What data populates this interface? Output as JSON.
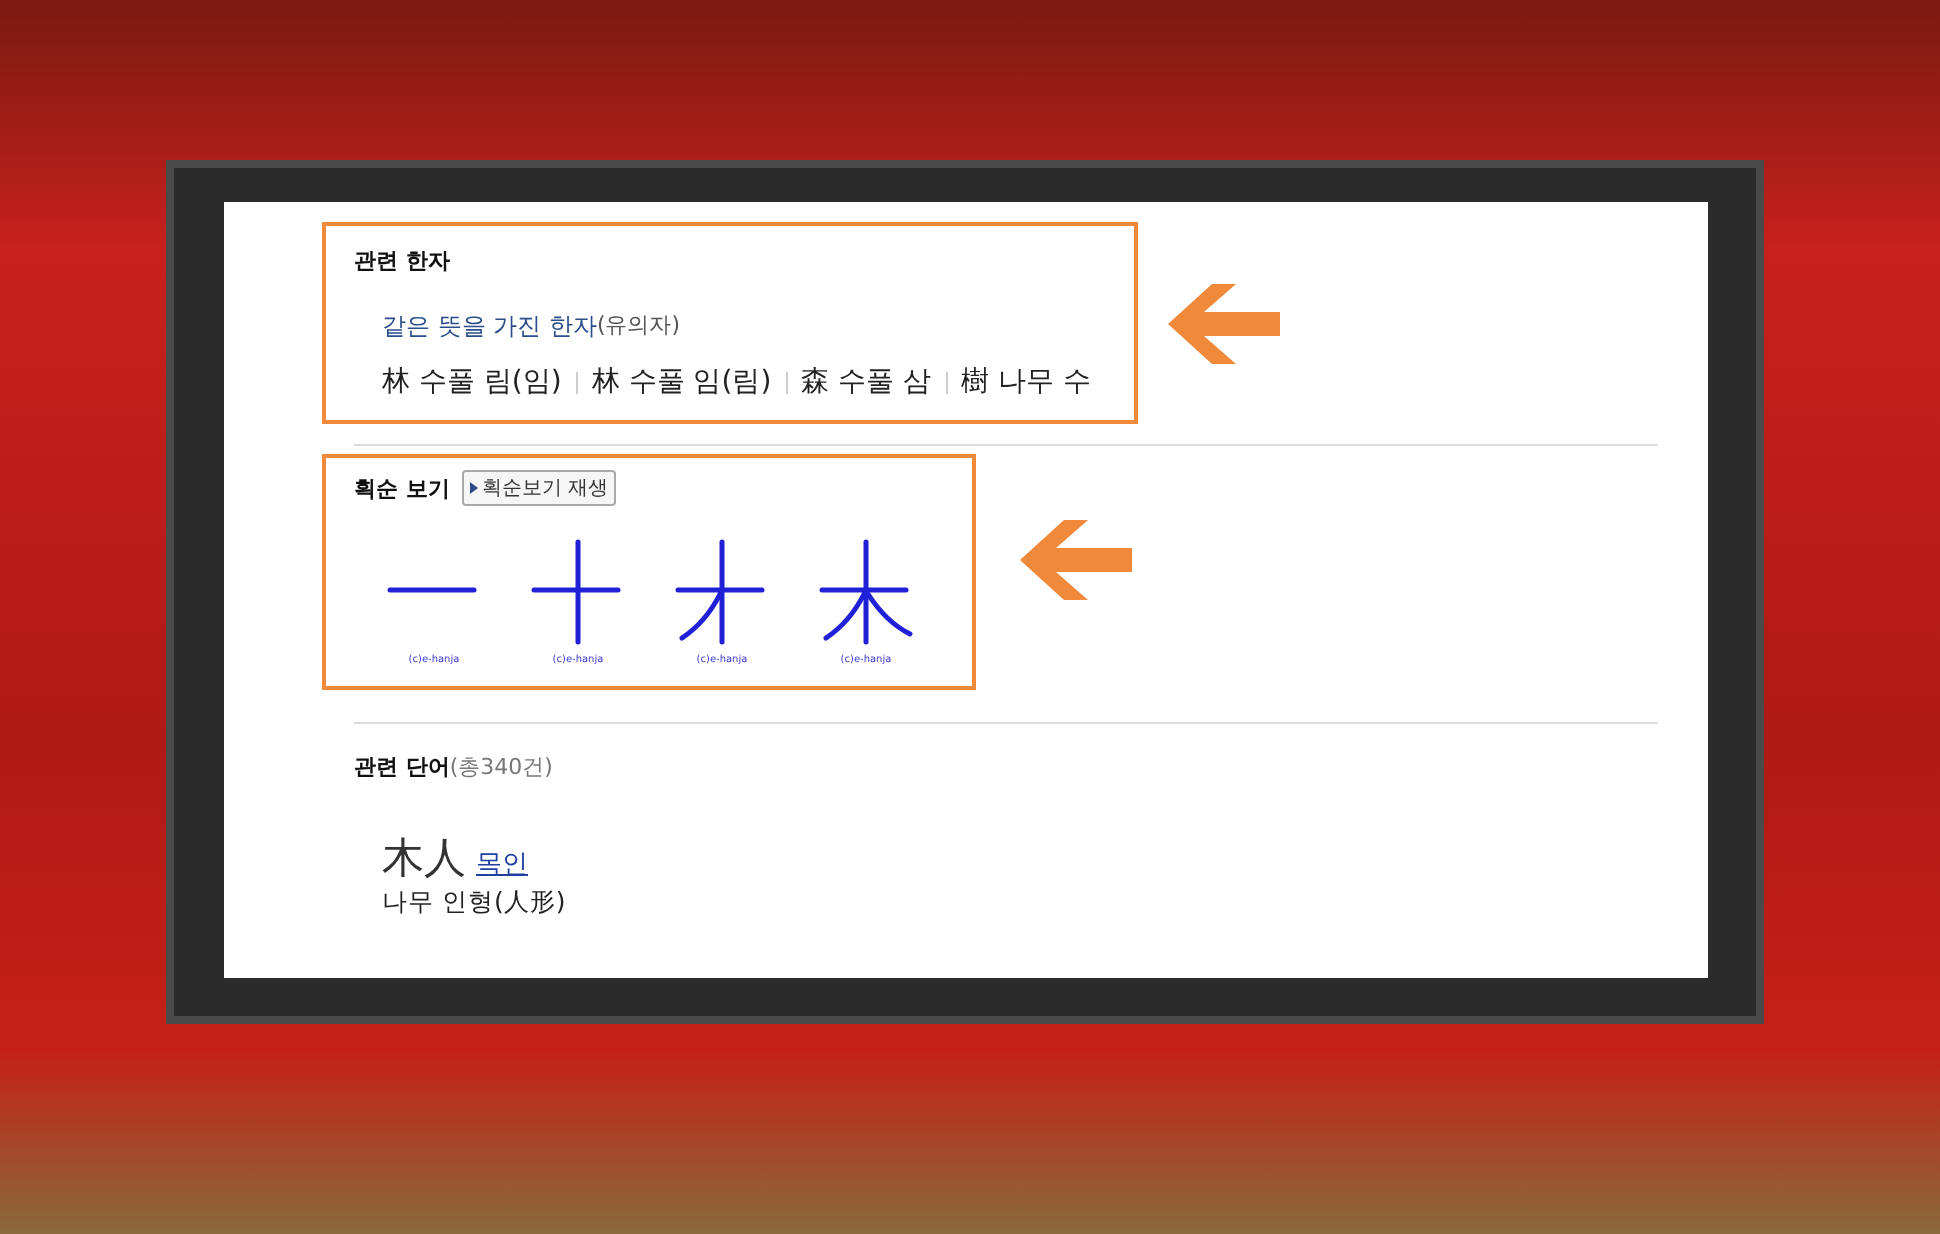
{
  "related_hanja": {
    "title": "관련 한자",
    "synonym_heading": "같은 뜻을 가진 한자",
    "synonym_note": "(유의자)",
    "items": [
      "林 수풀 림(임)",
      "林 수풀 임(림)",
      "森 수풀 삼",
      "樹 나무 수"
    ]
  },
  "stroke_order": {
    "title": "획순 보기",
    "play_button": "획순보기 재생",
    "frames": [
      {
        "caption": "(c)e-hanja"
      },
      {
        "caption": "(c)e-hanja"
      },
      {
        "caption": "(c)e-hanja"
      },
      {
        "caption": "(c)e-hanja"
      }
    ]
  },
  "related_words": {
    "title": "관련 단어",
    "count": "(총340건)",
    "words": [
      {
        "hanja": "木人",
        "reading": "목인",
        "meaning": "나무 인형(人形)"
      }
    ]
  }
}
